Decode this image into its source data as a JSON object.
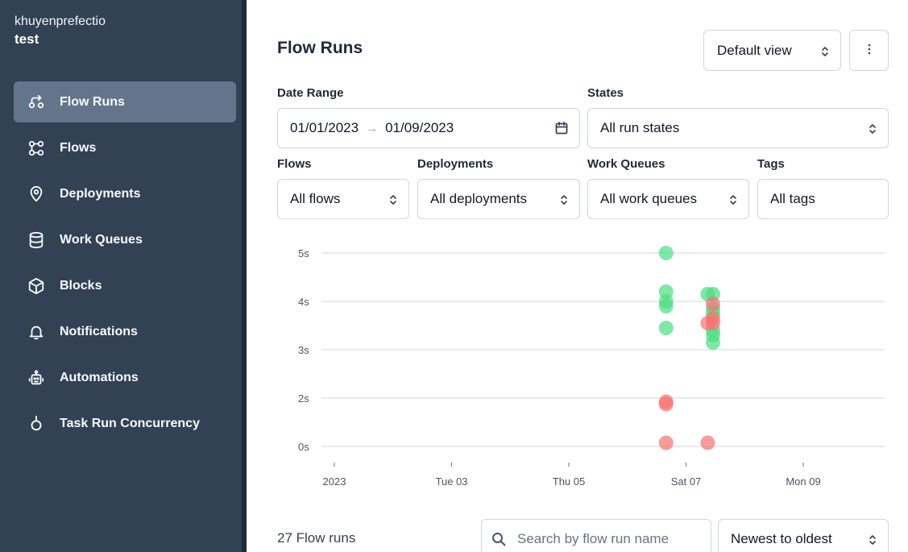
{
  "sidebar": {
    "account": "khuyenprefectio",
    "workspace": "test",
    "items": [
      {
        "label": "Flow Runs",
        "icon": "flow-runs-icon",
        "active": true
      },
      {
        "label": "Flows",
        "icon": "flows-icon"
      },
      {
        "label": "Deployments",
        "icon": "map-pin-icon"
      },
      {
        "label": "Work Queues",
        "icon": "database-icon"
      },
      {
        "label": "Blocks",
        "icon": "cube-icon"
      },
      {
        "label": "Notifications",
        "icon": "bell-icon"
      },
      {
        "label": "Automations",
        "icon": "robot-icon"
      },
      {
        "label": "Task Run Concurrency",
        "icon": "concurrency-icon"
      }
    ]
  },
  "header": {
    "title": "Flow Runs",
    "view_select": "Default view",
    "menu_icon": "more-vertical-icon"
  },
  "filters": {
    "date_range": {
      "label": "Date Range",
      "start": "01/01/2023",
      "arrow": "→",
      "end": "01/09/2023"
    },
    "states": {
      "label": "States",
      "value": "All run states"
    },
    "flows": {
      "label": "Flows",
      "value": "All flows"
    },
    "deployments": {
      "label": "Deployments",
      "value": "All deployments"
    },
    "work_queues": {
      "label": "Work Queues",
      "value": "All work queues"
    },
    "tags": {
      "label": "Tags",
      "value": "All tags"
    }
  },
  "chart_data": {
    "type": "scatter",
    "x_ticks": [
      "2023",
      "Tue 03",
      "Thu 05",
      "Sat 07",
      "Mon 09"
    ],
    "y_ticks": [
      "5s",
      "4s",
      "3s",
      "2s",
      "0s"
    ],
    "colors": {
      "completed": "#4ade80",
      "failed": "#f87171"
    },
    "series": [
      {
        "state": "completed",
        "points": [
          {
            "x": 6.66,
            "y": 5.0
          },
          {
            "x": 6.66,
            "y": 4.2
          },
          {
            "x": 6.66,
            "y": 4.0
          },
          {
            "x": 6.66,
            "y": 3.9
          },
          {
            "x": 6.66,
            "y": 3.45
          },
          {
            "x": 7.37,
            "y": 4.15
          },
          {
            "x": 7.46,
            "y": 4.15
          },
          {
            "x": 7.46,
            "y": 3.85
          },
          {
            "x": 7.46,
            "y": 3.75
          },
          {
            "x": 7.46,
            "y": 3.4
          },
          {
            "x": 7.46,
            "y": 3.3
          },
          {
            "x": 7.46,
            "y": 3.15
          }
        ]
      },
      {
        "state": "failed",
        "points": [
          {
            "x": 6.66,
            "y": 1.85
          },
          {
            "x": 6.66,
            "y": 1.75
          },
          {
            "x": 6.66,
            "y": 0.15
          },
          {
            "x": 7.37,
            "y": 3.55
          },
          {
            "x": 7.37,
            "y": 0.15
          },
          {
            "x": 7.46,
            "y": 3.95
          },
          {
            "x": 7.46,
            "y": 3.65
          },
          {
            "x": 7.46,
            "y": 3.55
          }
        ]
      }
    ]
  },
  "footer": {
    "count": "27 Flow runs",
    "search_placeholder": "Search by flow run name",
    "sort": "Newest to oldest"
  }
}
